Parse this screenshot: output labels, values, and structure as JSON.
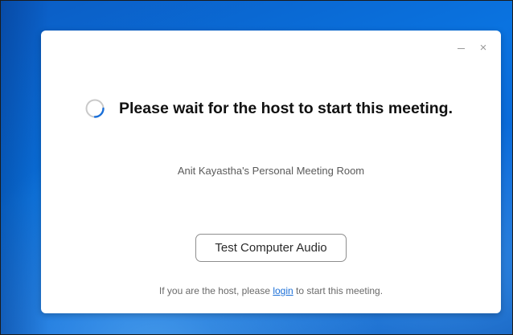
{
  "window": {
    "minimize_icon": "minimize-icon",
    "close_icon": "close-icon",
    "close_glyph": "×"
  },
  "waiting": {
    "spinner_icon": "loading-spinner-icon",
    "title": "Please wait for the host to start this meeting.",
    "room_name": "Anit Kayastha's Personal Meeting Room"
  },
  "actions": {
    "test_audio_label": "Test Computer Audio"
  },
  "footer": {
    "prefix": "If you are the host, please ",
    "login_link": "login",
    "suffix": " to start this meeting."
  },
  "colors": {
    "accent_link": "#1a6fd8",
    "spinner": "#1a6fd8",
    "desktop_blue": "#0a73e0"
  }
}
